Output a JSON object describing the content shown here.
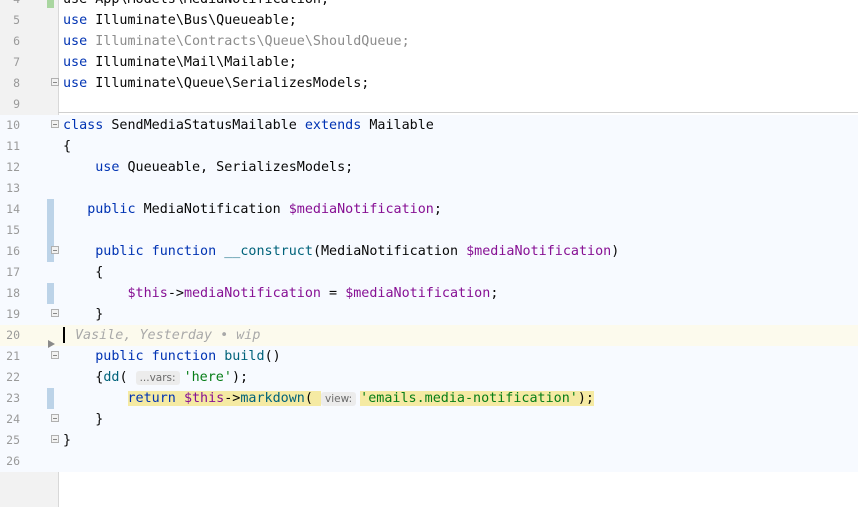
{
  "lines": [
    {
      "n": "4",
      "parts": [
        {
          "t": "use App\\Models\\MediaNotification;",
          "c": ""
        }
      ]
    },
    {
      "n": "5",
      "parts": [
        {
          "t": "use",
          "c": "kw"
        },
        {
          "t": " Illuminate\\Bus\\Queueable;",
          "c": ""
        }
      ]
    },
    {
      "n": "6",
      "parts": [
        {
          "t": "use",
          "c": "kw"
        },
        {
          "t": " Illuminate\\Contracts\\Queue\\ShouldQueue;",
          "c": "gray"
        }
      ]
    },
    {
      "n": "7",
      "parts": [
        {
          "t": "use",
          "c": "kw"
        },
        {
          "t": " Illuminate\\Mail\\Mailable;",
          "c": ""
        }
      ]
    },
    {
      "n": "8",
      "parts": [
        {
          "t": "use",
          "c": "kw"
        },
        {
          "t": " Illuminate\\Queue\\SerializesModels;",
          "c": ""
        }
      ]
    },
    {
      "n": "9",
      "parts": []
    },
    {
      "n": "10",
      "parts": [
        {
          "t": "class",
          "c": "kw"
        },
        {
          "t": " SendMediaStatusMailable ",
          "c": ""
        },
        {
          "t": "extends",
          "c": "kw"
        },
        {
          "t": " Mailable",
          "c": ""
        }
      ]
    },
    {
      "n": "11",
      "parts": [
        {
          "t": "{",
          "c": ""
        }
      ]
    },
    {
      "n": "12",
      "parts": [
        {
          "t": "    ",
          "c": ""
        },
        {
          "t": "use",
          "c": "kw"
        },
        {
          "t": " Queueable, SerializesModels;",
          "c": ""
        }
      ]
    },
    {
      "n": "13",
      "parts": []
    },
    {
      "n": "14",
      "parts": [
        {
          "t": "   ",
          "c": ""
        },
        {
          "t": "public",
          "c": "kw"
        },
        {
          "t": " MediaNotification ",
          "c": ""
        },
        {
          "t": "$mediaNotification",
          "c": "var"
        },
        {
          "t": ";",
          "c": ""
        }
      ]
    },
    {
      "n": "15",
      "parts": []
    },
    {
      "n": "16",
      "parts": [
        {
          "t": "    ",
          "c": ""
        },
        {
          "t": "public function",
          "c": "kw"
        },
        {
          "t": " ",
          "c": ""
        },
        {
          "t": "__construct",
          "c": "fn"
        },
        {
          "t": "(MediaNotification ",
          "c": ""
        },
        {
          "t": "$mediaNotification",
          "c": "var"
        },
        {
          "t": ")",
          "c": ""
        }
      ]
    },
    {
      "n": "17",
      "parts": [
        {
          "t": "    {",
          "c": ""
        }
      ]
    },
    {
      "n": "18",
      "parts": [
        {
          "t": "        ",
          "c": ""
        },
        {
          "t": "$this",
          "c": "var"
        },
        {
          "t": "->",
          "c": ""
        },
        {
          "t": "mediaNotification",
          "c": "var"
        },
        {
          "t": " = ",
          "c": ""
        },
        {
          "t": "$mediaNotification",
          "c": "var"
        },
        {
          "t": ";",
          "c": ""
        }
      ]
    },
    {
      "n": "19",
      "parts": [
        {
          "t": "    }",
          "c": ""
        }
      ]
    },
    {
      "n": "20",
      "parts": [
        {
          "t": "Vasile, Yesterday • wip",
          "c": "blame"
        }
      ]
    },
    {
      "n": "21",
      "parts": [
        {
          "t": "    ",
          "c": ""
        },
        {
          "t": "public function",
          "c": "kw"
        },
        {
          "t": " ",
          "c": ""
        },
        {
          "t": "build",
          "c": "fn"
        },
        {
          "t": "()",
          "c": ""
        }
      ]
    },
    {
      "n": "22",
      "parts": [
        {
          "t": "    {",
          "c": ""
        },
        {
          "t": "dd",
          "c": "fn"
        },
        {
          "t": "( ",
          "c": ""
        },
        {
          "t": "...vars:",
          "c": "hint"
        },
        {
          "t": "'here'",
          "c": "str"
        },
        {
          "t": ");",
          "c": ""
        }
      ]
    },
    {
      "n": "23",
      "parts": [
        {
          "t": "        ",
          "c": ""
        },
        {
          "t": "return",
          "c": "kw hl"
        },
        {
          "t": " ",
          "c": "hl"
        },
        {
          "t": "$this",
          "c": "var hl"
        },
        {
          "t": "->",
          "c": "hl"
        },
        {
          "t": "markdown",
          "c": "fn hl"
        },
        {
          "t": "( ",
          "c": "hl"
        },
        {
          "t": "view:",
          "c": "hint"
        },
        {
          "t": "'emails.media-notification'",
          "c": "str hl"
        },
        {
          "t": ");",
          "c": "hl"
        }
      ]
    },
    {
      "n": "24",
      "parts": [
        {
          "t": "    }",
          "c": ""
        }
      ]
    },
    {
      "n": "25",
      "parts": [
        {
          "t": "}",
          "c": ""
        }
      ]
    },
    {
      "n": "26",
      "parts": []
    }
  ]
}
